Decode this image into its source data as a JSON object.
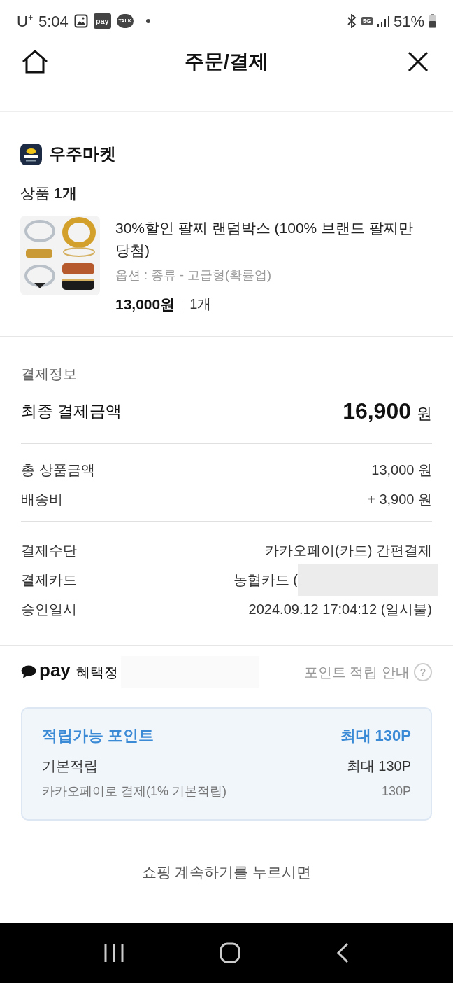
{
  "status_bar": {
    "carrier": "U⁺",
    "time": "5:04",
    "notifications": [
      "pay",
      "TALK"
    ],
    "network": "5G",
    "battery": "51%"
  },
  "header": {
    "title": "주문/결제"
  },
  "shop": {
    "name": "우주마켓"
  },
  "product_count": {
    "label": "상품",
    "count": "1개"
  },
  "product": {
    "title": "30%할인 팔찌 랜덤박스 (100% 브랜드 팔찌만 당첨)",
    "option": "옵션 : 종류 - 고급형(확률업)",
    "price": "13,000원",
    "quantity": "1개"
  },
  "payment_info": {
    "heading": "결제정보",
    "total_label": "최종 결제금액",
    "total_amount": "16,900",
    "total_unit": "원",
    "lines": [
      {
        "label": "총 상품금액",
        "value": "13,000 원"
      },
      {
        "label": "배송비",
        "value": "+ 3,900 원"
      }
    ],
    "details": [
      {
        "label": "결제수단",
        "value": "카카오페이(카드) 간편결제",
        "redacted": false
      },
      {
        "label": "결제카드",
        "value": "농협카드 (",
        "redacted": true
      },
      {
        "label": "승인일시",
        "value": "2024.09.12 17:04:12 (일시불)",
        "redacted": false
      }
    ]
  },
  "benefits": {
    "logo": "pay",
    "title": "혜택정",
    "guide_link": "포인트 적립 안내",
    "help": "?",
    "points_card": {
      "title": "적립가능 포인트",
      "title_value": "최대 130P",
      "rows": [
        {
          "label": "기본적립",
          "value": "최대 130P",
          "kind": "main"
        },
        {
          "label": "카카오페이로 결제(1% 기본적립)",
          "value": "130P",
          "kind": "sub"
        }
      ]
    }
  },
  "footer_note": "쇼핑 계속하기를 누르시면"
}
